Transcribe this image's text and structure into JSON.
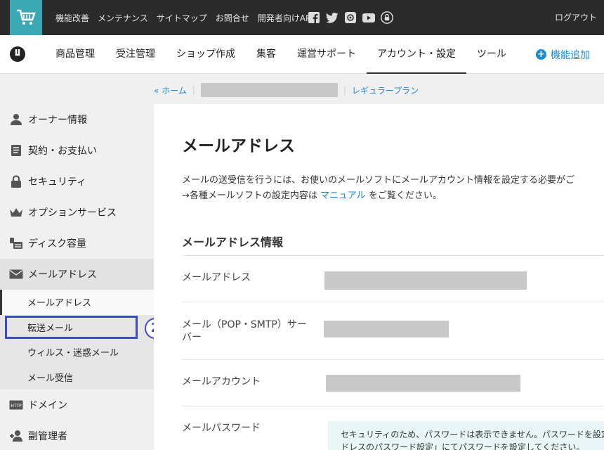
{
  "top_links": [
    "機能改善",
    "メンテナンス",
    "サイトマップ",
    "お問合せ",
    "開発者向けAPI"
  ],
  "social_icons": [
    "facebook-icon",
    "twitter-icon",
    "mail-icon",
    "youtube-icon",
    "lock-icon"
  ],
  "logout": "ログアウト",
  "nav": {
    "items": [
      "商品管理",
      "受注管理",
      "ショップ作成",
      "集客",
      "運営サポート",
      "アカウント・設定",
      "ツール"
    ],
    "active_index": 5,
    "add": "機能追加"
  },
  "breadcrumb": {
    "home": "« ホーム",
    "plan": "レギュラープラン"
  },
  "sidebar": {
    "items": [
      {
        "label": "オーナー情報",
        "icon": "person-icon"
      },
      {
        "label": "契約・お支払い",
        "icon": "document-icon"
      },
      {
        "label": "セキュリティ",
        "icon": "lock-icon"
      },
      {
        "label": "オプションサービス",
        "icon": "crown-icon"
      },
      {
        "label": "ディスク容量",
        "icon": "disk-icon"
      },
      {
        "label": "メールアドレス",
        "icon": "envelope-icon"
      }
    ],
    "subitems": [
      "メールアドレス",
      "転送メール",
      "ウィルス・迷惑メール",
      "メール受信"
    ],
    "bottom_items": [
      {
        "label": "ドメイン",
        "icon": "http-icon"
      },
      {
        "label": "副管理者",
        "icon": "add-user-icon"
      }
    ],
    "step_number": "2"
  },
  "main": {
    "title": "メールアドレス",
    "desc_line1": "メールの送受信を行うには、お使いのメールソフトにメールアカウント情報を設定する必要がご",
    "desc_prefix": "→各種メールソフトの設定内容は",
    "desc_link": "マニュアル",
    "desc_suffix": "をご覧ください。",
    "section_title": "メールアドレス情報",
    "rows": [
      {
        "label": "メールアドレス"
      },
      {
        "label": "メール（POP・SMTP）サーバー"
      },
      {
        "label": "メールアカウント"
      },
      {
        "label": "メールパスワード"
      }
    ],
    "notice_line1": "セキュリティのため、パスワードは表示できません。パスワードを設定",
    "notice_line2": "ドレスのパスワード設定」にてパスワードを設定してください。"
  },
  "colors": {
    "accent": "#1a8ad4",
    "logo_bg": "#3aa7b5",
    "highlight": "#3b4bc8"
  }
}
